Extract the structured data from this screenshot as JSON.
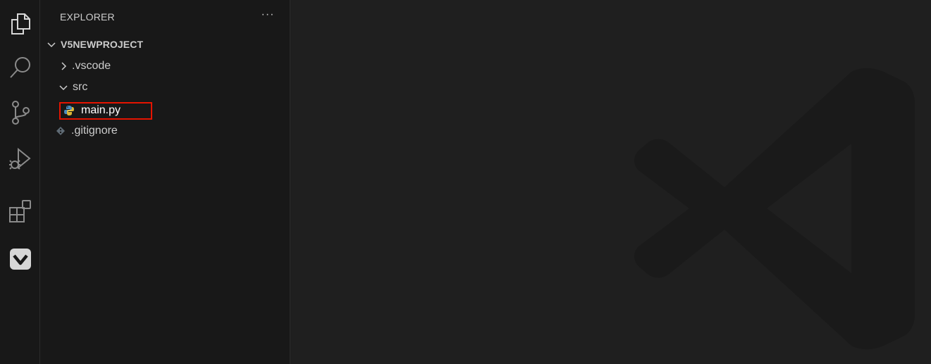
{
  "activity_bar": {
    "items": [
      {
        "icon": "explorer-icon"
      },
      {
        "icon": "search-icon"
      },
      {
        "icon": "source-control-icon"
      },
      {
        "icon": "run-debug-icon"
      },
      {
        "icon": "extensions-icon"
      },
      {
        "icon": "vex-extension-icon"
      }
    ]
  },
  "sidebar": {
    "title": "EXPLORER",
    "more_actions": "···",
    "root": {
      "label": "V5NEWPROJECT",
      "expanded": true
    },
    "items": [
      {
        "label": ".vscode",
        "type": "folder",
        "expanded": false
      },
      {
        "label": "src",
        "type": "folder",
        "expanded": true
      },
      {
        "label": "main.py",
        "type": "file",
        "icon": "python-icon",
        "highlighted": true
      },
      {
        "label": ".gitignore",
        "type": "file",
        "icon": "git-icon"
      }
    ]
  },
  "editor": {
    "watermark": "vscode-logo-icon"
  },
  "colors": {
    "background": "#1f1f1f",
    "sidebar": "#181818",
    "text": "#cccccc",
    "highlight": "#e51400",
    "python_icon": "#4b8bbe"
  }
}
